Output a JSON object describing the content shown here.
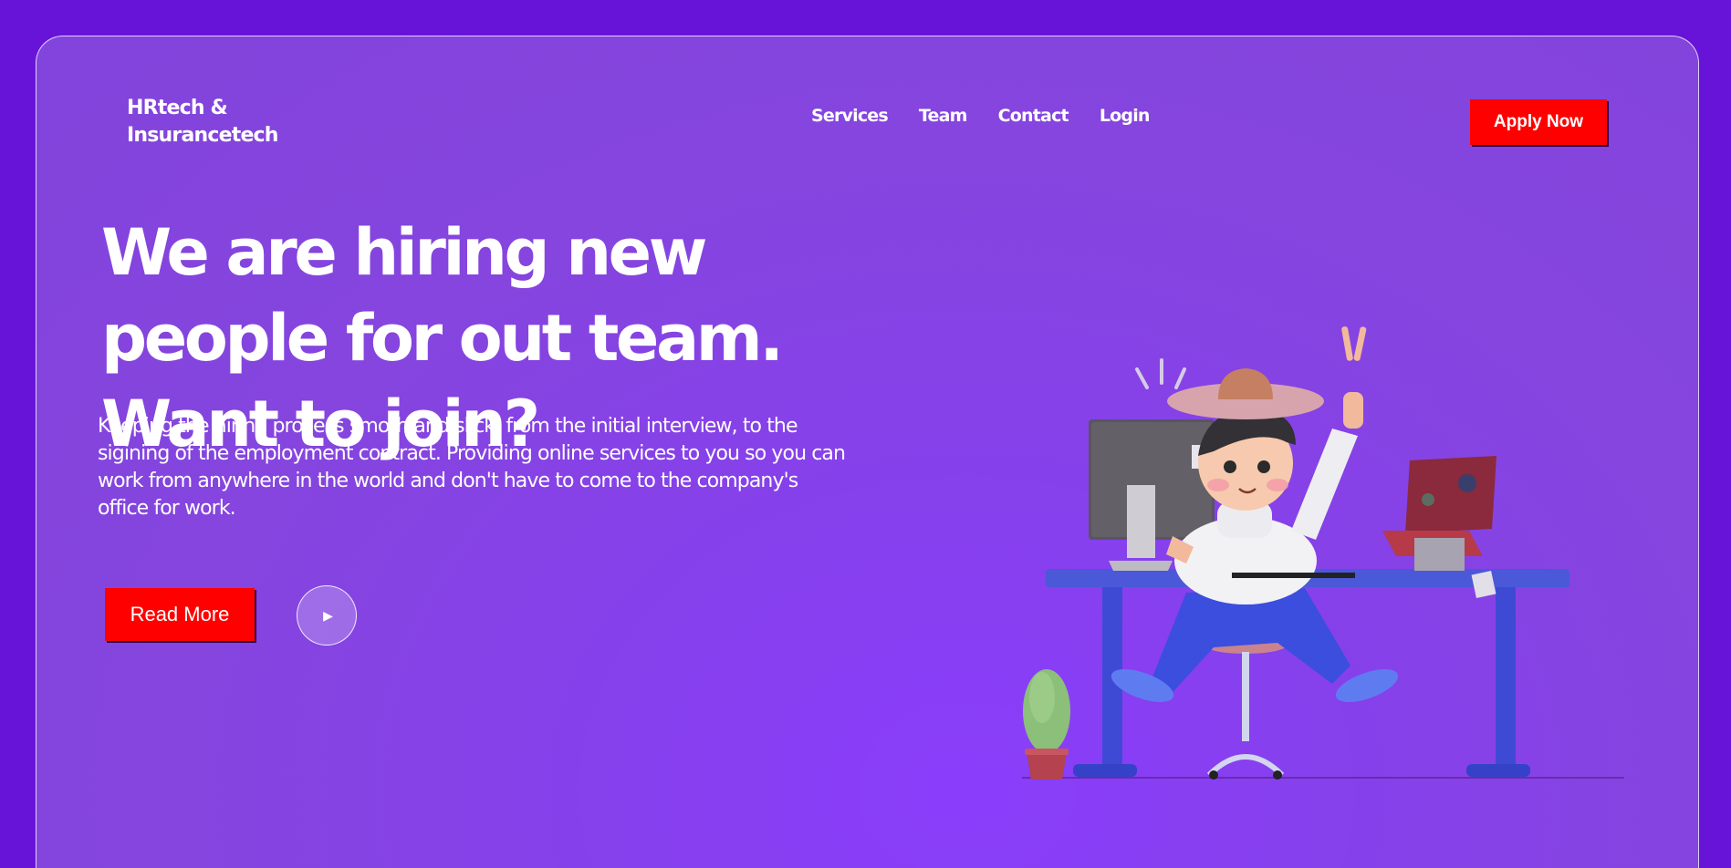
{
  "header": {
    "logo": "HRtech & Insurancetech",
    "nav": [
      "Services",
      "Team",
      "Contact",
      "Login"
    ],
    "cta_label": "Apply Now"
  },
  "hero": {
    "headline": "We are hiring new people for out team. Want to join?",
    "description": "Keeping the hiring process smoth and slick, from the initial interview, to the sigining of the employment contract. Providing online services to you so you can work from anywhere in the world and don't have to come to the company's office for work.",
    "read_more_label": "Read More",
    "play_icon": "play-icon"
  },
  "colors": {
    "background": "#6814d8",
    "panel": "#8545de",
    "button": "#ff0000",
    "text": "#ffffff"
  }
}
